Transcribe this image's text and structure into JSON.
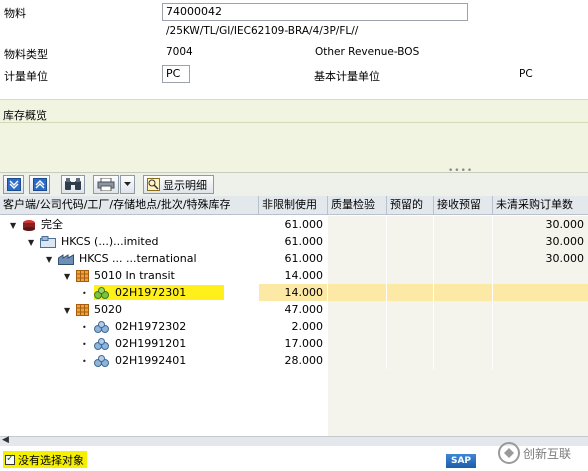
{
  "material": {
    "label": "物料",
    "value": "74000042",
    "description": "/25KW/TL/GI/IEC62109-BRA/4/3P/FL//"
  },
  "material_type": {
    "label": "物料类型",
    "code": "7004",
    "text": "Other Revenue-BOS"
  },
  "uom": {
    "label": "计量单位",
    "value": "PC",
    "base_label": "基本计量单位",
    "base_value": "PC"
  },
  "section": {
    "title": "库存概览"
  },
  "toolbar": {
    "detail_label": "显示明细"
  },
  "table": {
    "headers": [
      "客户端/公司代码/工厂/存储地点/批次/特殊库存",
      "非限制使用",
      "质量检验",
      "预留的",
      "接收预留",
      "未清采购订单数"
    ],
    "rows": [
      {
        "label": "完全",
        "c1": "61.000",
        "c5": "30.000"
      },
      {
        "label": "HKCS (...)...imited",
        "c1": "61.000",
        "c5": "30.000"
      },
      {
        "label": "HKCS ... ...ternational",
        "c1": "61.000",
        "c5": "30.000"
      },
      {
        "label": "5010 In transit",
        "c1": "14.000"
      },
      {
        "label": "02H1972301",
        "c1": "14.000"
      },
      {
        "label": "5020",
        "c1": "47.000"
      },
      {
        "label": "02H1972302",
        "c1": "2.000"
      },
      {
        "label": "02H1991201",
        "c1": "17.000"
      },
      {
        "label": "02H1992401",
        "c1": "28.000"
      }
    ]
  },
  "status": {
    "message": "没有选择对象"
  },
  "branding": {
    "sap": "SAP",
    "watermark": "创新互联"
  }
}
